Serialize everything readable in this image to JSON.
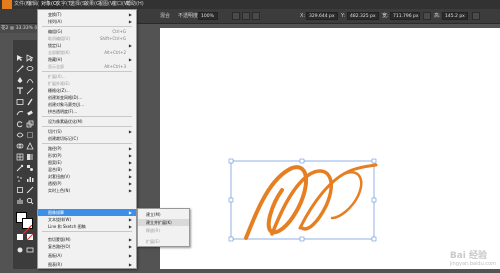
{
  "menubar": {
    "items": [
      "文件(F)",
      "编辑(E)",
      "对象(O)",
      "文字(T)",
      "选择(S)",
      "效果(C)",
      "视图(V)",
      "窗口(W)",
      "帮助(H)"
    ]
  },
  "controlbar": {
    "blend_label": "混合",
    "opacity_label": "不透明度",
    "opacity_value": "100%",
    "x_label": "X:",
    "x_value": "329.644 px",
    "y_label": "Y:",
    "y_value": "482.325 px",
    "w_label": "宽:",
    "w_value": "711.796 px",
    "h_label": "高:",
    "h_value": "145.2 px"
  },
  "document_tab": {
    "label": "花2 @ 33.33% (RGB"
  },
  "object_menu": {
    "items": [
      {
        "label": "变换(T)",
        "shortcut": "",
        "submenu": true,
        "disabled": false
      },
      {
        "label": "排列(A)",
        "shortcut": "",
        "submenu": true,
        "disabled": false
      },
      {
        "label": "编组(G)",
        "shortcut": "Ctrl+G",
        "submenu": false,
        "disabled": false
      },
      {
        "label": "取消编组(U)",
        "shortcut": "Shift+Ctrl+G",
        "submenu": false,
        "disabled": true
      },
      {
        "label": "锁定(L)",
        "shortcut": "",
        "submenu": true,
        "disabled": false
      },
      {
        "label": "全部解锁(K)",
        "shortcut": "Alt+Ctrl+2",
        "submenu": false,
        "disabled": true
      },
      {
        "label": "隐藏(H)",
        "shortcut": "",
        "submenu": true,
        "disabled": false
      },
      {
        "label": "显示全部",
        "shortcut": "Alt+Ctrl+3",
        "submenu": false,
        "disabled": true
      },
      {
        "label": "扩展(X)...",
        "shortcut": "",
        "submenu": false,
        "disabled": true
      },
      {
        "label": "扩展外观(E)",
        "shortcut": "",
        "submenu": false,
        "disabled": true
      },
      {
        "label": "栅格化(Z)...",
        "shortcut": "",
        "submenu": false,
        "disabled": false
      },
      {
        "label": "创建渐变网格(D)...",
        "shortcut": "",
        "submenu": false,
        "disabled": false
      },
      {
        "label": "创建对象马赛克(J)...",
        "shortcut": "",
        "submenu": false,
        "disabled": false
      },
      {
        "label": "拼合透明度(F)...",
        "shortcut": "",
        "submenu": false,
        "disabled": false
      },
      {
        "label": "设为像素级优化(M)",
        "shortcut": "",
        "submenu": false,
        "disabled": false
      },
      {
        "label": "切片(S)",
        "shortcut": "",
        "submenu": true,
        "disabled": false
      },
      {
        "label": "创建裁切标记(C)",
        "shortcut": "",
        "submenu": false,
        "disabled": false
      },
      {
        "label": "路径(P)",
        "shortcut": "",
        "submenu": true,
        "disabled": false
      },
      {
        "label": "形状(P)",
        "shortcut": "",
        "submenu": true,
        "disabled": false
      },
      {
        "label": "图案(E)",
        "shortcut": "",
        "submenu": true,
        "disabled": false
      },
      {
        "label": "混合(B)",
        "shortcut": "",
        "submenu": true,
        "disabled": false
      },
      {
        "label": "封套扭曲(V)",
        "shortcut": "",
        "submenu": true,
        "disabled": false
      },
      {
        "label": "透视(P)",
        "shortcut": "",
        "submenu": true,
        "disabled": false
      },
      {
        "label": "实时上色(N)",
        "shortcut": "",
        "submenu": true,
        "disabled": false
      },
      {
        "label": "图像描摹",
        "shortcut": "",
        "submenu": true,
        "disabled": false,
        "highlighted": true
      },
      {
        "label": "文本绕排(W)",
        "shortcut": "",
        "submenu": true,
        "disabled": false
      },
      {
        "label": "Line 和 Sketch 图稿",
        "shortcut": "",
        "submenu": true,
        "disabled": false
      },
      {
        "label": "剪切蒙版(M)",
        "shortcut": "",
        "submenu": true,
        "disabled": false
      },
      {
        "label": "复合路径(O)",
        "shortcut": "",
        "submenu": true,
        "disabled": false
      },
      {
        "label": "画板(A)",
        "shortcut": "",
        "submenu": true,
        "disabled": false
      },
      {
        "label": "图表(R)",
        "shortcut": "",
        "submenu": true,
        "disabled": false
      }
    ]
  },
  "trace_submenu": {
    "items": [
      {
        "label": "建立(M)",
        "disabled": false,
        "selected": false
      },
      {
        "label": "建立并扩展(K)",
        "disabled": false,
        "selected": true
      },
      {
        "label": "释放(R)",
        "disabled": true,
        "selected": false
      },
      {
        "label": "扩展(E)",
        "disabled": true,
        "selected": false
      }
    ]
  },
  "watermark": {
    "text": "Bai 经验",
    "sub": "jingyan.baidu.com"
  },
  "colors": {
    "artwork": "#e67e22",
    "selection": "#4a7fd4",
    "highlight": "#3d8ee6"
  }
}
